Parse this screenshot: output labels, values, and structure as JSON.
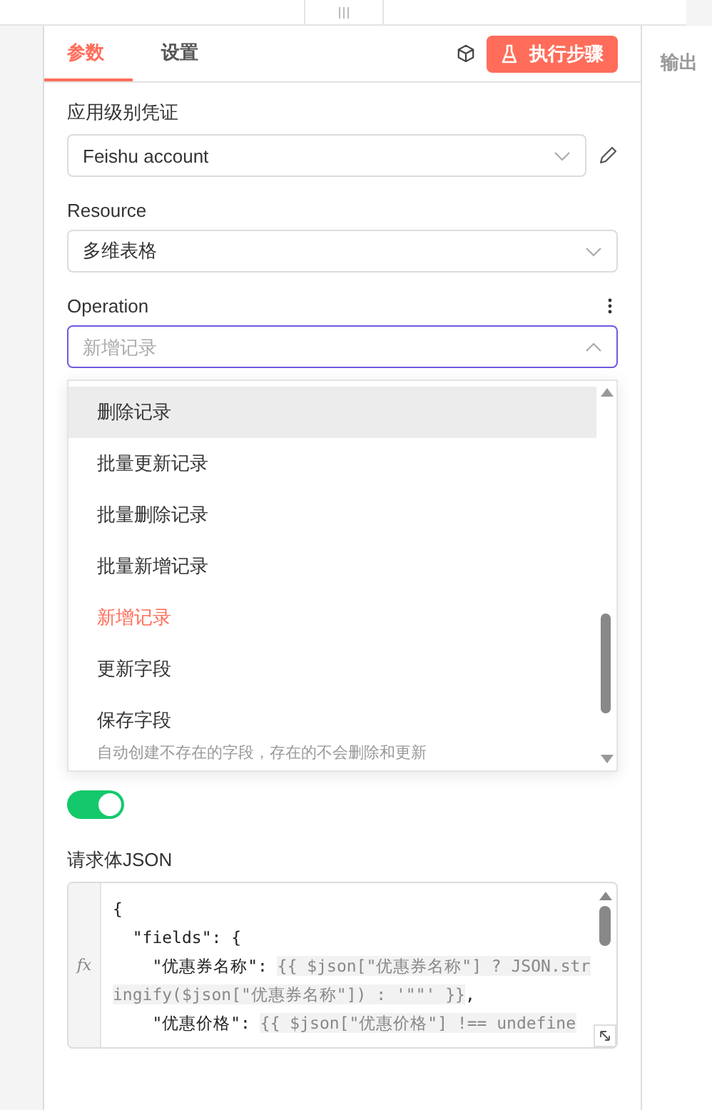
{
  "tabs": [
    {
      "label": "参数",
      "selected": true
    },
    {
      "label": "设置",
      "selected": false
    }
  ],
  "run_button": {
    "label": "执行步骤"
  },
  "output_panel": {
    "title": "输出"
  },
  "credential": {
    "label": "应用级别凭证",
    "value": "Feishu account"
  },
  "resource": {
    "label": "Resource",
    "value": "多维表格"
  },
  "operation": {
    "label": "Operation",
    "placeholder": "新增记录",
    "expanded": true,
    "options": [
      {
        "label": "删除记录",
        "selected": false,
        "highlighted": true
      },
      {
        "label": "批量更新记录",
        "selected": false,
        "highlighted": false
      },
      {
        "label": "批量删除记录",
        "selected": false,
        "highlighted": false
      },
      {
        "label": "批量新增记录",
        "selected": false,
        "highlighted": false
      },
      {
        "label": "新增记录",
        "selected": true,
        "highlighted": false
      },
      {
        "label": "更新字段",
        "selected": false,
        "highlighted": false
      },
      {
        "label": "保存字段",
        "selected": false,
        "highlighted": false,
        "description": "自动创建不存在的字段，存在的不会删除和更新"
      }
    ]
  },
  "toggle": {
    "on": true
  },
  "request_body": {
    "label": "请求体JSON",
    "gutter": "fx",
    "lines": [
      [
        {
          "kind": "text",
          "text": "{"
        }
      ],
      [
        {
          "kind": "text",
          "text": "  \"fields\": {"
        }
      ],
      [
        {
          "kind": "text",
          "text": "    \"优惠券名称\": "
        },
        {
          "kind": "expr",
          "text": "{{ $json[\"优惠券名称\"] ? JSON.stringify($json[\"优惠券名称\"]) : '\"\"' }}"
        },
        {
          "kind": "text",
          "text": ","
        }
      ],
      [
        {
          "kind": "text",
          "text": "    \"优惠价格\": "
        },
        {
          "kind": "expr",
          "text": "{{ $json[\"优惠价格\"] !== undefine"
        }
      ]
    ]
  }
}
